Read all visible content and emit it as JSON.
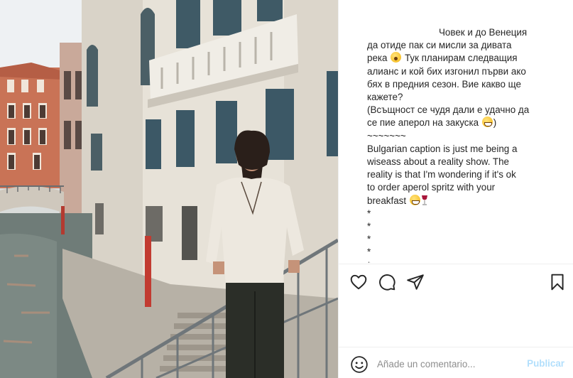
{
  "caption": {
    "lines": [
      "Човек и до Венеция",
      "да отиде пак си мисли за дивата",
      "река",
      "Тук планирам следващия",
      "алианс и кой бих изгонил първи ако",
      "бях в предния сезон. Вие какво ще",
      "кажете?",
      "(Всъщност се чудя дали е удачно да",
      "се пие аперол на закуска",
      "~~~~~~~",
      "Bulgarian caption is just me being a",
      "wiseass about a reality show. The",
      "reality is that I'm wondering if it's ok",
      "to order aperol spritz with your",
      "breakfast",
      "*",
      "*",
      "*",
      "*",
      "*",
      "*"
    ],
    "close_paren": ")"
  },
  "actions": {
    "like_icon": "heart-icon",
    "comment_icon": "comment-icon",
    "share_icon": "paper-plane-icon",
    "save_icon": "bookmark-icon"
  },
  "comment": {
    "placeholder": "Añade un comentario...",
    "post_label": "Publicar",
    "emoji_icon": "smiley-icon"
  },
  "colors": {
    "text": "#262626",
    "muted": "#8e8e8e",
    "post_disabled": "#b2dffc",
    "divider": "#efefef"
  }
}
